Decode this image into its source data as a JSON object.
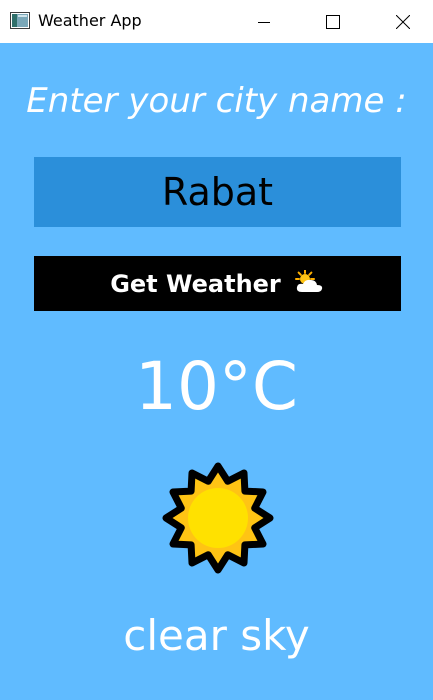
{
  "window": {
    "title": "Weather App",
    "app_icon": "window-app-icon",
    "controls": {
      "minimize_icon": "minimize-icon",
      "maximize_icon": "maximize-icon",
      "close_icon": "close-icon"
    }
  },
  "form": {
    "prompt": "Enter your city name :",
    "city_value": "Rabat",
    "button_label": "Get Weather",
    "button_icon": "sun-behind-cloud-icon"
  },
  "result": {
    "temperature": "10°C",
    "emoji_icon": "sun-icon",
    "description": "clear sky"
  },
  "colors": {
    "background": "#60bbff",
    "input_background": "#2b8fda",
    "button_background": "#000000",
    "text_light": "#ffffff",
    "sun_fill": "#ffc414",
    "sun_core": "#ffe100"
  }
}
